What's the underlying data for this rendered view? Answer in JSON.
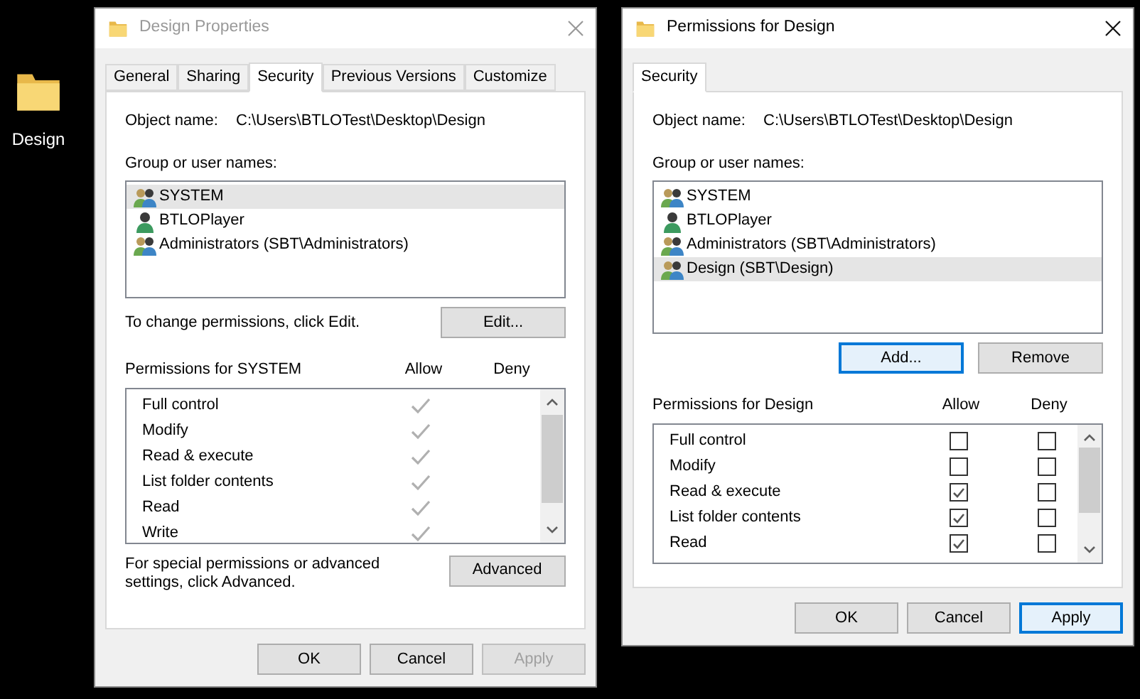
{
  "desktop_icons": [
    {
      "label": "Design"
    }
  ],
  "windows": [
    {
      "kind": "properties",
      "title": "Design Properties",
      "active": false,
      "tabs": [
        {
          "label": "General",
          "selected": false
        },
        {
          "label": "Sharing",
          "selected": false
        },
        {
          "label": "Security",
          "selected": true
        },
        {
          "label": "Previous Versions",
          "selected": false
        },
        {
          "label": "Customize",
          "selected": false
        }
      ],
      "object_name_label": "Object name:",
      "object_name": "C:\\Users\\BTLOTest\\Desktop\\Design",
      "group_label": "Group or user names:",
      "principals": [
        {
          "name": "SYSTEM",
          "kind": "group",
          "selected": true
        },
        {
          "name": "BTLOPlayer",
          "kind": "user",
          "selected": false
        },
        {
          "name": "Administrators (SBT\\Administrators)",
          "kind": "group",
          "selected": false
        }
      ],
      "change_hint": "To change permissions, click Edit.",
      "list_buttons": [
        {
          "label": "Edit...",
          "focused": false
        }
      ],
      "permissions_label": "Permissions for SYSTEM",
      "allow_label": "Allow",
      "deny_label": "Deny",
      "permissions": [
        {
          "name": "Full control",
          "disabled": true,
          "allow": true
        },
        {
          "name": "Modify",
          "disabled": true,
          "allow": true
        },
        {
          "name": "Read & execute",
          "disabled": true,
          "allow": true
        },
        {
          "name": "List folder contents",
          "disabled": true,
          "allow": true
        },
        {
          "name": "Read",
          "disabled": true,
          "allow": true
        },
        {
          "name": "Write",
          "disabled": true,
          "allow": true
        }
      ],
      "advanced_hint": "For special permissions or advanced settings, click Advanced.",
      "advanced_button": "Advanced",
      "buttons": [
        {
          "label": "OK",
          "disabled": false,
          "focused": false
        },
        {
          "label": "Cancel",
          "disabled": false,
          "focused": false
        },
        {
          "label": "Apply",
          "disabled": true,
          "focused": false
        }
      ]
    },
    {
      "kind": "permissions",
      "title": "Permissions for Design",
      "active": true,
      "tabs": [
        {
          "label": "Security",
          "selected": true
        }
      ],
      "object_name_label": "Object name:",
      "object_name": "C:\\Users\\BTLOTest\\Desktop\\Design",
      "group_label": "Group or user names:",
      "principals": [
        {
          "name": "SYSTEM",
          "kind": "group",
          "selected": false
        },
        {
          "name": "BTLOPlayer",
          "kind": "user",
          "selected": false
        },
        {
          "name": "Administrators (SBT\\Administrators)",
          "kind": "group",
          "selected": false
        },
        {
          "name": "Design (SBT\\Design)",
          "kind": "group",
          "selected": true
        }
      ],
      "list_buttons": [
        {
          "label": "Add...",
          "focused": true
        },
        {
          "label": "Remove",
          "focused": false
        }
      ],
      "permissions_label": "Permissions for Design",
      "allow_label": "Allow",
      "deny_label": "Deny",
      "permissions": [
        {
          "name": "Full control",
          "disabled": false,
          "allow": false,
          "deny": false
        },
        {
          "name": "Modify",
          "disabled": false,
          "allow": false,
          "deny": false
        },
        {
          "name": "Read & execute",
          "disabled": false,
          "allow": true,
          "deny": false
        },
        {
          "name": "List folder contents",
          "disabled": false,
          "allow": true,
          "deny": false
        },
        {
          "name": "Read",
          "disabled": false,
          "allow": true,
          "deny": false
        }
      ],
      "buttons": [
        {
          "label": "OK",
          "disabled": false,
          "focused": false
        },
        {
          "label": "Cancel",
          "disabled": false,
          "focused": false
        },
        {
          "label": "Apply",
          "disabled": false,
          "focused": true
        }
      ]
    }
  ]
}
